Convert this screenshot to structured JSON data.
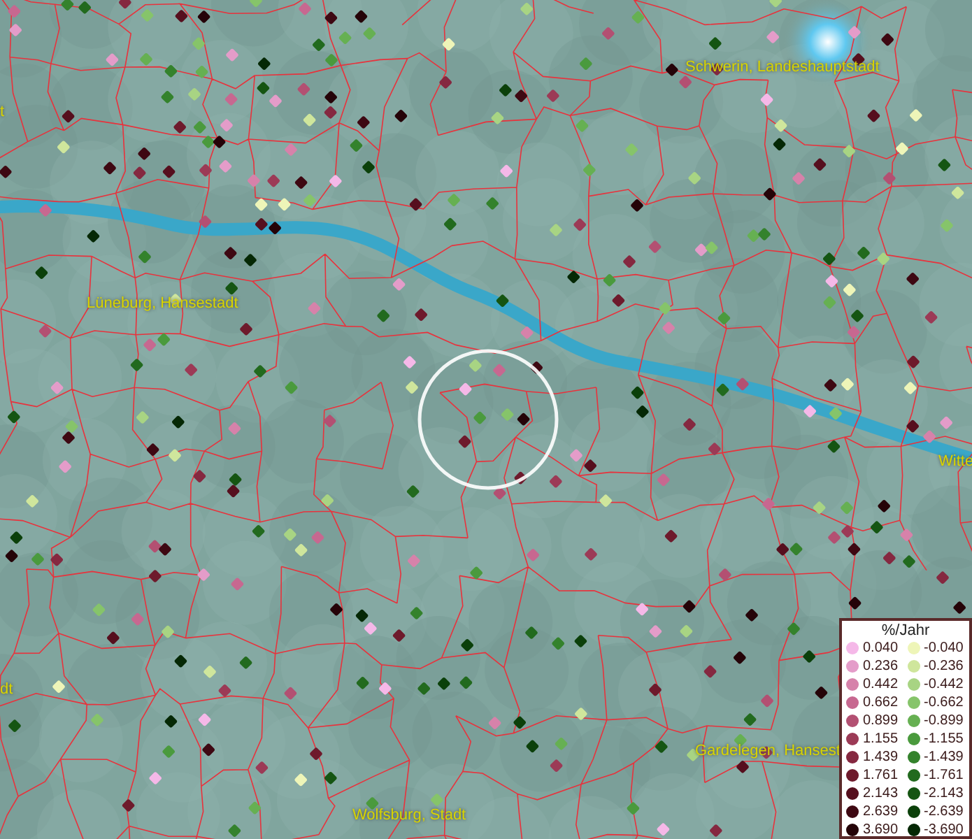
{
  "map": {
    "place_labels": [
      {
        "text": "Schwerin, Landeshauptstadt",
        "kind": "city"
      },
      {
        "text": "Lüneburg, Hansestadt",
        "kind": "city"
      },
      {
        "text": "Gardelegen, Hansest",
        "kind": "city"
      },
      {
        "text": "Wolfsburg, Stadt",
        "kind": "city"
      },
      {
        "text": "Witte",
        "kind": "city"
      },
      {
        "text": "t",
        "kind": "city"
      },
      {
        "text": "dt",
        "kind": "city"
      }
    ]
  },
  "legend": {
    "title": "%/Jahr",
    "positive": [
      {
        "label": "0.040",
        "color": "#f5b8e8"
      },
      {
        "label": "0.236",
        "color": "#e49cc9"
      },
      {
        "label": "0.442",
        "color": "#d682aa"
      },
      {
        "label": "0.662",
        "color": "#c76890"
      },
      {
        "label": "0.899",
        "color": "#b35072"
      },
      {
        "label": "1.155",
        "color": "#9c3a56"
      },
      {
        "label": "1.439",
        "color": "#852840"
      },
      {
        "label": "1.761",
        "color": "#6e1a2c"
      },
      {
        "label": "2.143",
        "color": "#560f1e"
      },
      {
        "label": "2.639",
        "color": "#3e0812"
      },
      {
        "label": "3.690",
        "color": "#250308"
      }
    ],
    "negative": [
      {
        "label": "-0.040",
        "color": "#eef5b8"
      },
      {
        "label": "-0.236",
        "color": "#cfe69c"
      },
      {
        "label": "-0.442",
        "color": "#a8d483"
      },
      {
        "label": "-0.662",
        "color": "#86c46a"
      },
      {
        "label": "-0.899",
        "color": "#66b052"
      },
      {
        "label": "-1.155",
        "color": "#4a9a3d"
      },
      {
        "label": "-1.439",
        "color": "#34822c"
      },
      {
        "label": "-1.761",
        "color": "#226a1e"
      },
      {
        "label": "-2.143",
        "color": "#155512"
      },
      {
        "label": "-2.639",
        "color": "#0b400a"
      },
      {
        "label": "-3.690",
        "color": "#052805"
      }
    ]
  }
}
